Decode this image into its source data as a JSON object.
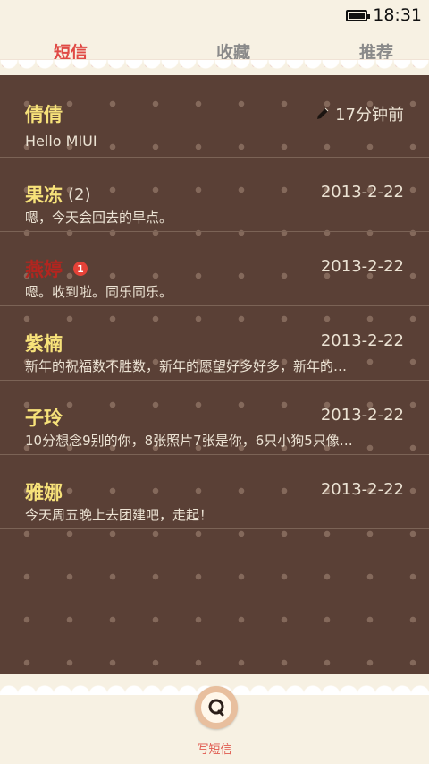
{
  "status_bar": {
    "time": "18:31"
  },
  "tabs": [
    {
      "label": "短信",
      "active": true
    },
    {
      "label": "收藏",
      "active": false
    },
    {
      "label": "推荐",
      "active": false
    }
  ],
  "conversations": [
    {
      "name": "倩倩",
      "count": "",
      "badge": "",
      "time": "17分钟前",
      "preview": "Hello MIUI",
      "draft": true
    },
    {
      "name": "果冻",
      "count": "(2)",
      "badge": "",
      "time": "2013-2-22",
      "preview": "嗯，今天会回去的早点。",
      "draft": false
    },
    {
      "name": "燕婷",
      "count": "",
      "badge": "1",
      "time": "2013-2-22",
      "preview": "嗯。收到啦。同乐同乐。",
      "draft": false
    },
    {
      "name": "紫楠",
      "count": "",
      "badge": "",
      "time": "2013-2-22",
      "preview": "新年的祝福数不胜数，新年的愿望好多好多，新年的…",
      "draft": false
    },
    {
      "name": "子玲",
      "count": "",
      "badge": "",
      "time": "2013-2-22",
      "preview": "10分想念9别的你，8张照片7张是你，6只小狗5只像…",
      "draft": false
    },
    {
      "name": "雅娜",
      "count": "",
      "badge": "",
      "time": "2013-2-22",
      "preview": "今天周五晚上去团建吧，走起！",
      "draft": false
    }
  ],
  "compose": {
    "label": "写短信",
    "icon": "compose-message-icon"
  },
  "colors": {
    "accent": "#e04a45",
    "list_bg": "#5a4036",
    "name": "#f7e27a",
    "unread_name": "#b3251f"
  }
}
